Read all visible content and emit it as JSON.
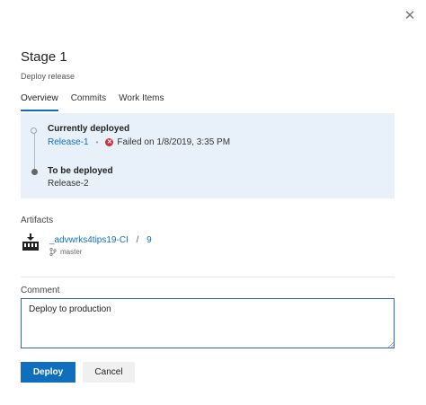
{
  "dialog": {
    "close_glyph": "✕",
    "title": "Stage 1",
    "subtitle": "Deploy release"
  },
  "tabs": [
    {
      "label": "Overview",
      "active": true
    },
    {
      "label": "Commits",
      "active": false
    },
    {
      "label": "Work Items",
      "active": false
    }
  ],
  "overview": {
    "currently_deployed_label": "Currently deployed",
    "current_release": "Release-1",
    "separator": "•",
    "status_icon": "x-circle-icon",
    "status_text": "Failed on 1/8/2019, 3:35 PM",
    "to_be_deployed_label": "To be deployed",
    "next_release": "Release-2"
  },
  "artifacts": {
    "heading": "Artifacts",
    "items": [
      {
        "name": "_advwrks4tips19-CI",
        "slash": "/",
        "version": "9",
        "branch": "master"
      }
    ]
  },
  "comment": {
    "label": "Comment",
    "value": "Deploy to production"
  },
  "actions": {
    "deploy_label": "Deploy",
    "cancel_label": "Cancel"
  },
  "colors": {
    "accent": "#106ebe",
    "overview_bg": "#e8f1fa",
    "failed": "#c8323a"
  }
}
